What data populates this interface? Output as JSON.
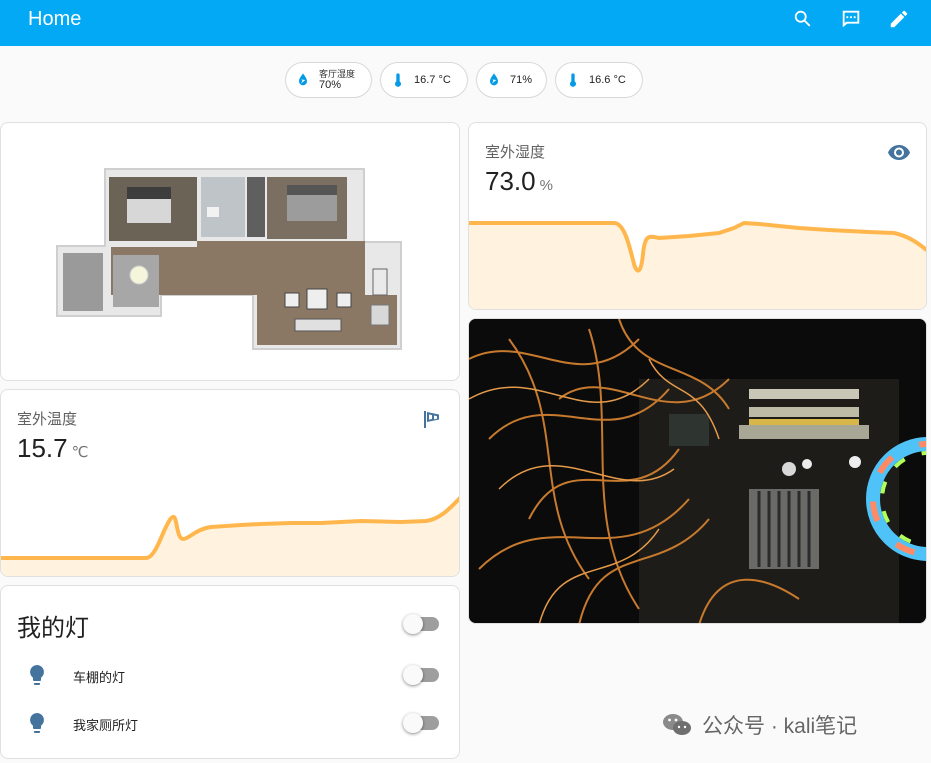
{
  "header": {
    "title": "Home",
    "icons": [
      "search-icon",
      "chat-icon",
      "pencil-icon"
    ]
  },
  "badges": [
    {
      "icon": "water-drop-icon",
      "name": "客厅湿度",
      "value": "70%"
    },
    {
      "icon": "thermometer-icon",
      "value": "16.7 °C"
    },
    {
      "icon": "water-drop-icon",
      "value": "71%"
    },
    {
      "icon": "thermometer-icon",
      "value": "16.6 °C"
    }
  ],
  "outdoor_humidity": {
    "name": "室外湿度",
    "value": "73.0",
    "unit": "%",
    "icon": "eye-icon",
    "color": "#ffb74d"
  },
  "outdoor_temp": {
    "name": "室外温度",
    "value": "15.7",
    "unit": "℃",
    "icon": "windsock-icon",
    "color": "#ffb74d"
  },
  "lights": {
    "title": "我的灯",
    "master_state": "off",
    "items": [
      {
        "icon": "lightbulb-icon",
        "name": "车棚的灯",
        "state": "off"
      },
      {
        "icon": "lightbulb-icon",
        "name": "我家厕所灯",
        "state": "off"
      }
    ]
  },
  "colors": {
    "header": "#03a9f4",
    "accent_icon": "#44739e",
    "badge_icon": "#039be5",
    "graph_line": "#ffb74d"
  },
  "watermark": {
    "text": "公众号 · kali笔记",
    "icon": "wechat-icon"
  }
}
